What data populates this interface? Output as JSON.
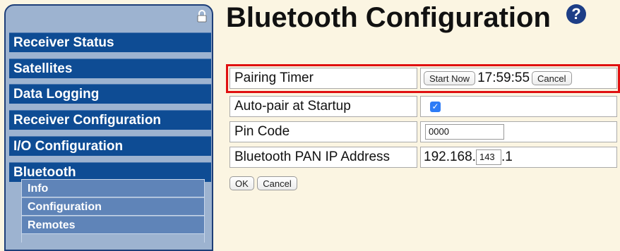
{
  "sidebar": {
    "nav_items": [
      {
        "label": "Receiver Status"
      },
      {
        "label": "Satellites"
      },
      {
        "label": "Data Logging"
      },
      {
        "label": "Receiver Configuration"
      },
      {
        "label": "I/O Configuration"
      },
      {
        "label": "Bluetooth"
      }
    ],
    "sub_items": [
      {
        "label": "Info"
      },
      {
        "label": "Configuration"
      },
      {
        "label": "Remotes"
      }
    ]
  },
  "page": {
    "title": "Bluetooth Configuration",
    "help_symbol": "?"
  },
  "config": {
    "pairing_timer": {
      "label": "Pairing Timer",
      "start_button": "Start Now",
      "time": "17:59:55",
      "cancel_button": "Cancel"
    },
    "auto_pair": {
      "label": "Auto-pair at Startup",
      "checked": true,
      "check_glyph": "✓"
    },
    "pin_code": {
      "label": "Pin Code",
      "value": "0000"
    },
    "pan_ip": {
      "label": "Bluetooth PAN IP Address",
      "prefix": "192.168.",
      "octet": "143",
      "suffix": ".1"
    }
  },
  "form": {
    "ok_label": "OK",
    "cancel_label": "Cancel"
  },
  "colors": {
    "accent_highlight": "#e01010",
    "nav_bg": "#0e4c94",
    "sub_nav_bg": "#5f84b8",
    "page_bg": "#fbf5e2"
  },
  "icons": {
    "lock": "lock-icon",
    "help": "help-icon"
  }
}
